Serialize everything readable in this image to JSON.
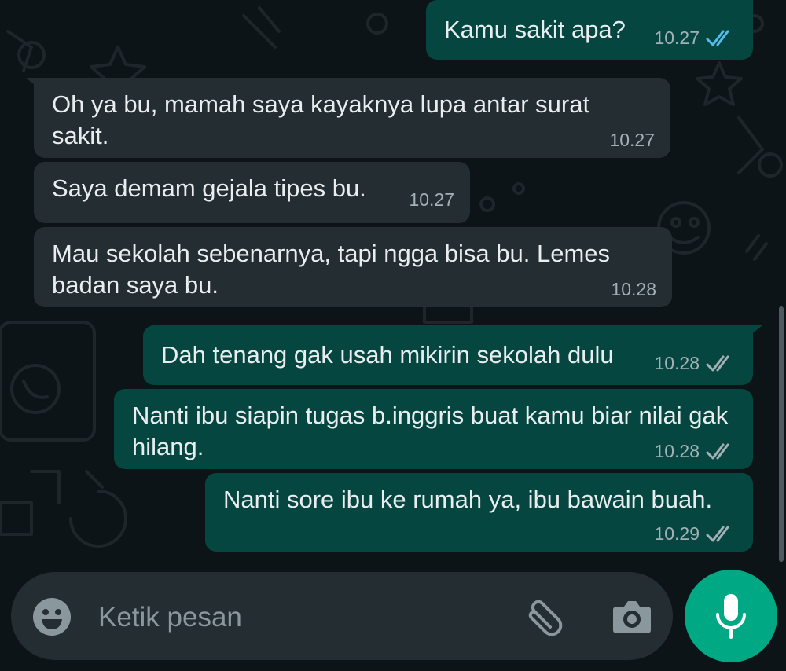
{
  "colors": {
    "background": "#0d1418",
    "incoming_bubble": "#232d32",
    "outgoing_bubble": "#054740",
    "text": "#e9edef",
    "timestamp": "#a3b1b6",
    "read_tick": "#53bdeb",
    "delivered_tick": "#a3b1b6",
    "accent": "#00a884"
  },
  "messages": [
    {
      "direction": "out",
      "text": "Kamu sakit apa?",
      "time": "10.27",
      "status": "read"
    },
    {
      "direction": "in",
      "text": "Oh ya bu, mamah saya kayaknya lupa antar surat sakit.",
      "time": "10.27"
    },
    {
      "direction": "in",
      "text": "Saya demam gejala tipes bu.",
      "time": "10.27"
    },
    {
      "direction": "in",
      "text": "Mau sekolah sebenarnya, tapi ngga bisa bu. Lemes badan saya bu.",
      "time": "10.28"
    },
    {
      "direction": "out",
      "text": "Dah tenang gak usah mikirin sekolah dulu",
      "time": "10.28",
      "status": "delivered"
    },
    {
      "direction": "out",
      "text": "Nanti ibu siapin tugas b.inggris buat kamu biar nilai gak hilang.",
      "time": "10.28",
      "status": "delivered"
    },
    {
      "direction": "out",
      "text": "Nanti sore ibu ke rumah ya, ibu bawain buah.",
      "time": "10.29",
      "status": "delivered"
    }
  ],
  "composer": {
    "placeholder": "Ketik pesan",
    "value": "",
    "emoji_icon": "emoji-icon",
    "attach_icon": "paperclip-icon",
    "camera_icon": "camera-icon",
    "mic_icon": "microphone-icon"
  }
}
